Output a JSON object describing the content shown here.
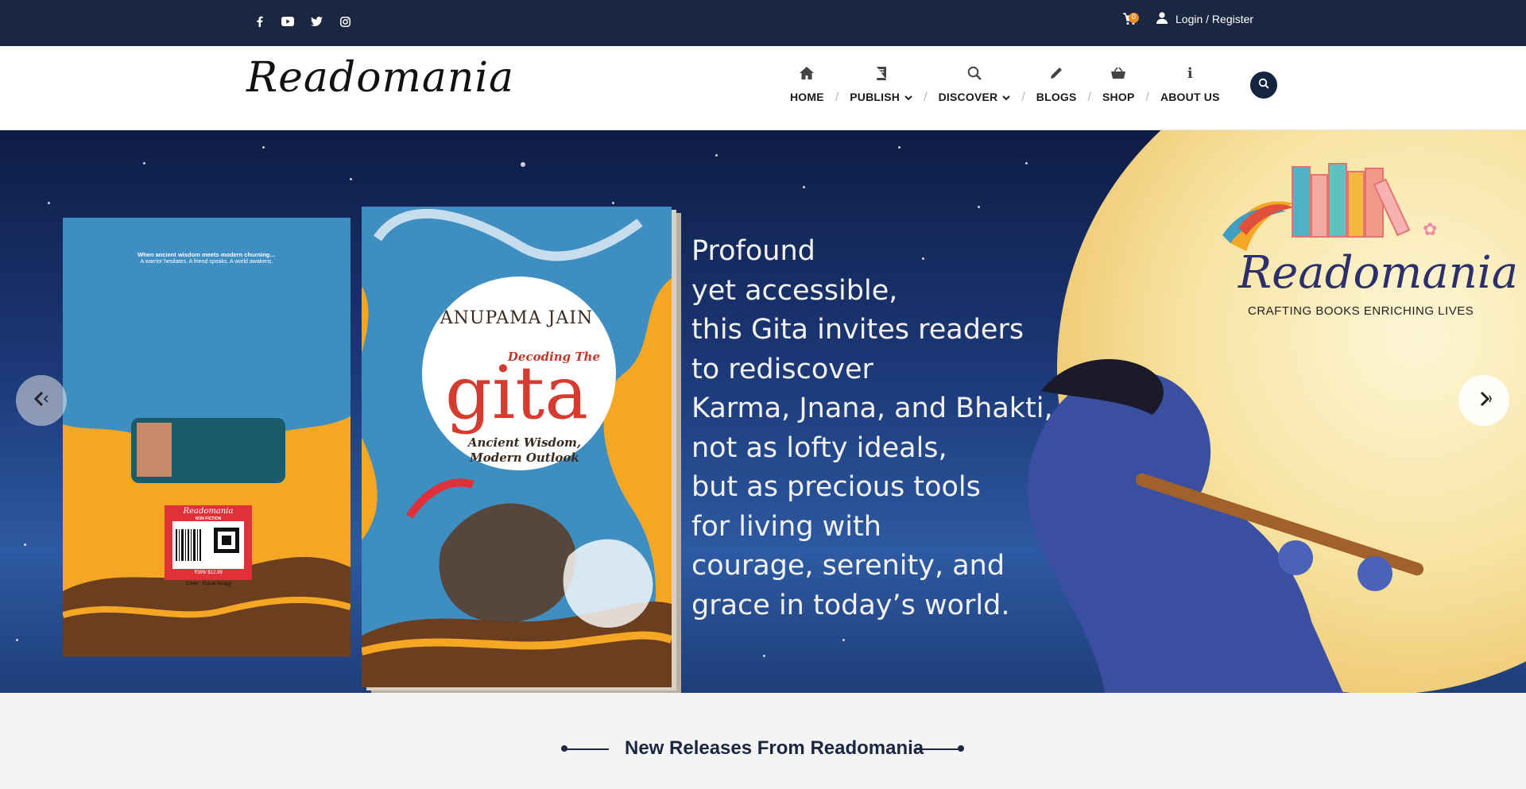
{
  "topbar": {
    "social_icons": [
      "facebook-icon",
      "youtube-icon",
      "twitter-icon",
      "instagram-icon"
    ],
    "cart_count": "0",
    "login_label": "Login / Register"
  },
  "header": {
    "logo_text": "Readomania",
    "nav": [
      {
        "label": "HOME",
        "icon": "home-icon",
        "dropdown": false
      },
      {
        "label": "PUBLISH",
        "icon": "book-icon",
        "dropdown": true
      },
      {
        "label": "DISCOVER",
        "icon": "search-icon",
        "dropdown": true
      },
      {
        "label": "BLOGS",
        "icon": "pencil-icon",
        "dropdown": false
      },
      {
        "label": "SHOP",
        "icon": "basket-icon",
        "dropdown": false
      },
      {
        "label": "ABOUT US",
        "icon": "info-icon",
        "dropdown": false
      }
    ]
  },
  "hero": {
    "book_author": "ANUPAMA JAIN",
    "book_title_top": "Decoding The",
    "book_title_main": "gita",
    "book_subtitle": "Ancient Wisdom, Modern Outlook",
    "back_cover_heading": "When ancient wisdom meets modern churning…",
    "back_cover_sub": "A warrior hesitates. A friend speaks. A world awakens.",
    "back_cover_publisher": "Readomania",
    "back_cover_category": "NON FICTION",
    "back_cover_price": "₹399/ $12.99",
    "back_cover_credit": "Cover : Rupali Neogy",
    "lines": [
      "Profound",
      "yet accessible,",
      "this Gita invites readers",
      "to rediscover",
      "Karma, Jnana, and Bhakti,",
      "not as lofty ideals,",
      "but as precious tools",
      "for living with",
      "courage, serenity, and",
      "grace in today’s world."
    ],
    "brand_name": "Readomania",
    "brand_tagline": "CRAFTING BOOKS ENRICHING LIVES"
  },
  "section": {
    "title": "New Releases From Readomania"
  },
  "colors": {
    "topbar": "#1b2640",
    "accent_orange": "#f08a24",
    "book_yellow": "#f5a623",
    "book_blue": "#3f8ec2",
    "title_red": "#d63b2f"
  }
}
